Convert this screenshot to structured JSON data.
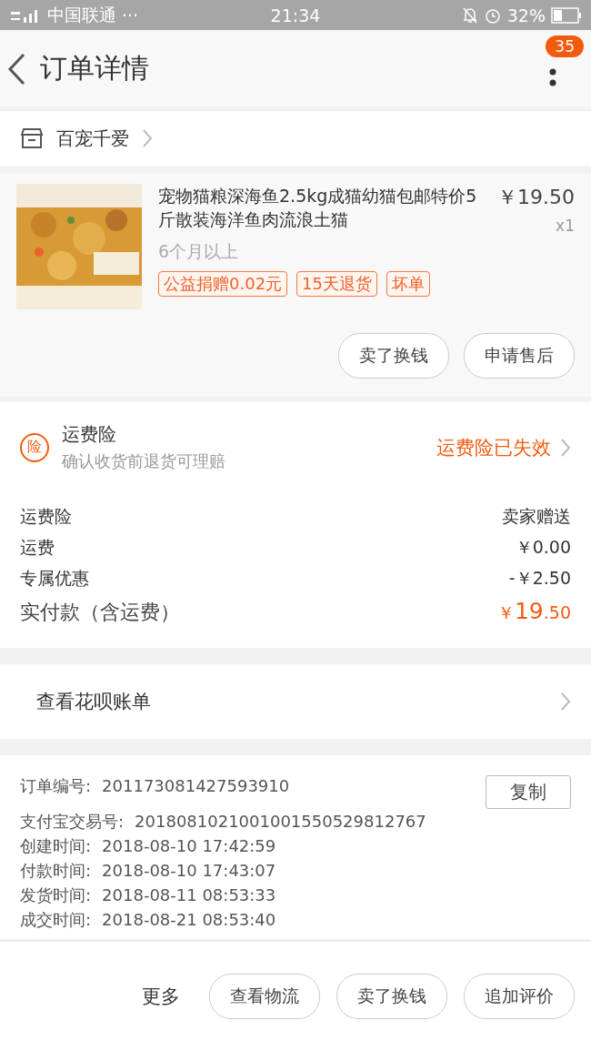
{
  "status_bar": {
    "carrier": "中国联通",
    "dots": "···",
    "time": "21:34",
    "battery": "32%"
  },
  "header": {
    "title": "订单详情",
    "badge": "35"
  },
  "shop": {
    "name": "百宠千爱"
  },
  "product": {
    "image": {
      "kind": "picture"
    },
    "title": "宠物猫粮深海鱼2.5kg成猫幼猫包邮特价5斤散装海洋鱼肉流浪土猫",
    "price": "￥19.50",
    "quantity": "x1",
    "spec": "6个月以上",
    "tags": [
      "公益捐赠0.02元",
      "15天退货",
      "坏单"
    ],
    "buttons": [
      "卖了换钱",
      "申请售后"
    ]
  },
  "insurance": {
    "icon_text": "险",
    "title": "运费险",
    "subtitle": "确认收货前退货可理赔",
    "status": "运费险已失效"
  },
  "fees": [
    {
      "label": "运费险",
      "value": "卖家赠送"
    },
    {
      "label": "运费",
      "value": "￥0.00"
    },
    {
      "label": "专属优惠",
      "value": "-￥2.50"
    }
  ],
  "total": {
    "label": "实付款（含运费）",
    "currency": "￥",
    "integer": "19",
    "decimal": ".50"
  },
  "huabei": {
    "label": "查看花呗账单"
  },
  "order_info": {
    "copy_button": "复制",
    "rows": [
      {
        "label": "订单编号:",
        "value": "201173081427593910"
      },
      {
        "label": "支付宝交易号:",
        "value": "2018081021001001550529812767"
      },
      {
        "label": "创建时间:",
        "value": "2018-08-10 17:42:59"
      },
      {
        "label": "付款时间:",
        "value": "2018-08-10 17:43:07"
      },
      {
        "label": "发货时间:",
        "value": "2018-08-11 08:53:33"
      },
      {
        "label": "成交时间:",
        "value": "2018-08-21 08:53:40"
      }
    ]
  },
  "bottom_bar": {
    "more": "更多",
    "buttons": [
      "查看物流",
      "卖了换钱",
      "追加评价"
    ]
  }
}
